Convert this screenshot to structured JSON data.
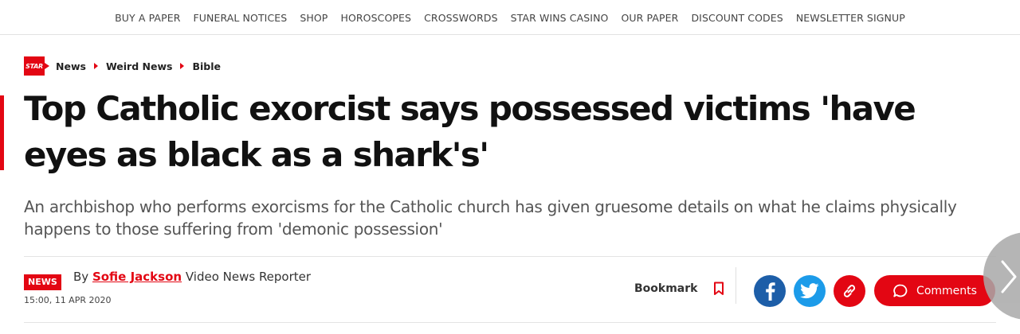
{
  "topnav": {
    "items": [
      "BUY A PAPER",
      "FUNERAL NOTICES",
      "SHOP",
      "HOROSCOPES",
      "CROSSWORDS",
      "STAR WINS CASINO",
      "OUR PAPER",
      "DISCOUNT CODES",
      "NEWSLETTER SIGNUP"
    ]
  },
  "brand": {
    "logo_text": "STAR",
    "accent": "#e30613"
  },
  "breadcrumb": [
    "News",
    "Weird News",
    "Bible"
  ],
  "article": {
    "headline": "Top Catholic exorcist says possessed victims 'have eyes as black as a shark's'",
    "standfirst": "An archbishop who performs exorcisms for the Catholic church has given gruesome details on what he claims physically happens to those suffering from 'demonic possession'",
    "tag": "NEWS",
    "by_prefix": "By",
    "author": "Sofie Jackson",
    "author_role": "Video News Reporter",
    "timestamp": "15:00, 11 APR 2020"
  },
  "actions": {
    "bookmark_label": "Bookmark",
    "comments_label": "Comments"
  },
  "icons": [
    "bookmark-icon",
    "facebook-icon",
    "twitter-icon",
    "link-icon",
    "comment-bubble-icon",
    "chevron-right-icon"
  ],
  "colors": {
    "facebook": "#1d5ea8",
    "twitter": "#1c9be9",
    "link": "#e30613"
  }
}
